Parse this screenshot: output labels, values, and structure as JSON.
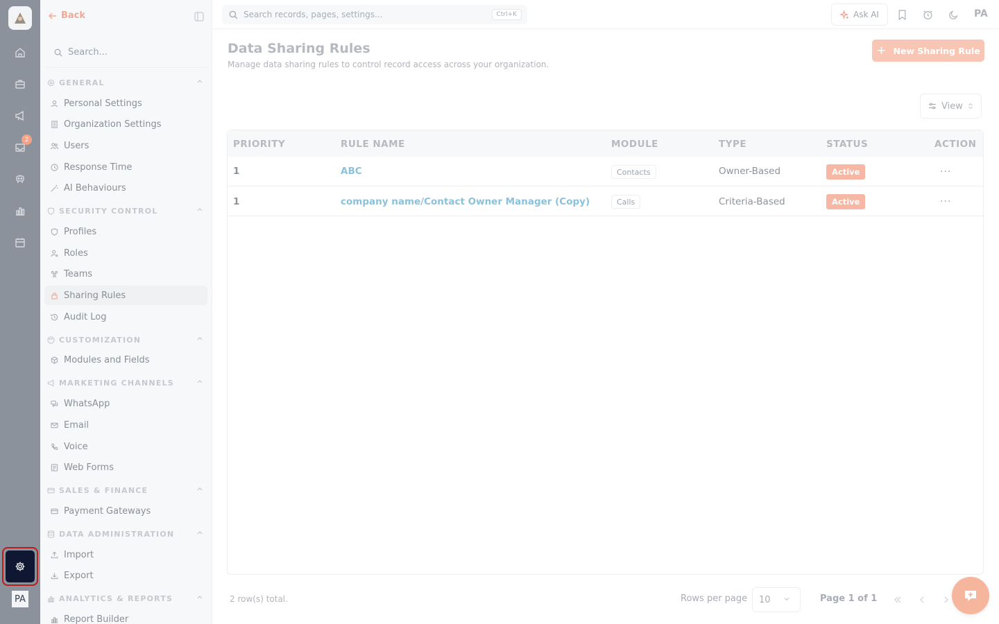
{
  "rail": {
    "badge_count": "2",
    "avatar_initials": "PA",
    "icons": [
      "home-icon",
      "briefcase-icon",
      "megaphone-icon",
      "inbox-icon",
      "robot-icon",
      "chart-icon",
      "calendar-icon",
      "settings-gear-icon"
    ]
  },
  "sidebar": {
    "back_label": "Back",
    "search_placeholder": "Search...",
    "sections": {
      "general": "GENERAL",
      "security": "SECURITY CONTROL",
      "customization": "CUSTOMIZATION",
      "marketing": "MARKETING CHANNELS",
      "sales": "SALES & FINANCE",
      "data_admin": "DATA ADMINISTRATION",
      "analytics": "ANALYTICS & REPORTS"
    },
    "items": {
      "personal": "Personal Settings",
      "organization": "Organization Settings",
      "users": "Users",
      "response_time": "Response Time",
      "ai_behaviours": "AI Behaviours",
      "profiles": "Profiles",
      "roles": "Roles",
      "teams": "Teams",
      "sharing_rules": "Sharing Rules",
      "audit_log": "Audit Log",
      "modules_fields": "Modules and Fields",
      "whatsapp": "WhatsApp",
      "email": "Email",
      "voice": "Voice",
      "web_forms": "Web Forms",
      "payment_gateways": "Payment Gateways",
      "import": "Import",
      "export": "Export",
      "report_builder": "Report Builder"
    }
  },
  "topbar": {
    "search_placeholder": "Search records, pages, settings...",
    "shortcut": "Ctrl+K",
    "ask_ai": "Ask AI",
    "avatar_initials": "PA"
  },
  "main": {
    "title": "Data Sharing Rules",
    "subtitle": "Manage data sharing rules to control record access across your organization.",
    "new_button": "New Sharing Rule",
    "view_button": "View",
    "columns": {
      "priority": "PRIORITY",
      "rule_name": "RULE NAME",
      "module": "MODULE",
      "type": "TYPE",
      "status": "STATUS",
      "action": "ACTION"
    },
    "rows": [
      {
        "priority": "1",
        "rule_name": "ABC",
        "module": "Contacts",
        "type": "Owner-Based",
        "status": "Active",
        "action": "..."
      },
      {
        "priority": "1",
        "rule_name": "company name/Contact Owner Manager (Copy)",
        "module": "Calls",
        "type": "Criteria-Based",
        "status": "Active",
        "action": "..."
      }
    ],
    "footer": {
      "total": "2 row(s) total.",
      "rows_per_page_label": "Rows per page",
      "rows_per_page_value": "10",
      "page_info": "Page 1 of 1"
    }
  },
  "colors": {
    "accent": "#f8c6b5",
    "link": "#8cc1dc",
    "rail": "#8c929b",
    "highlight_outline": "#b91c1c",
    "annotation_arrow": "#c0392b"
  }
}
